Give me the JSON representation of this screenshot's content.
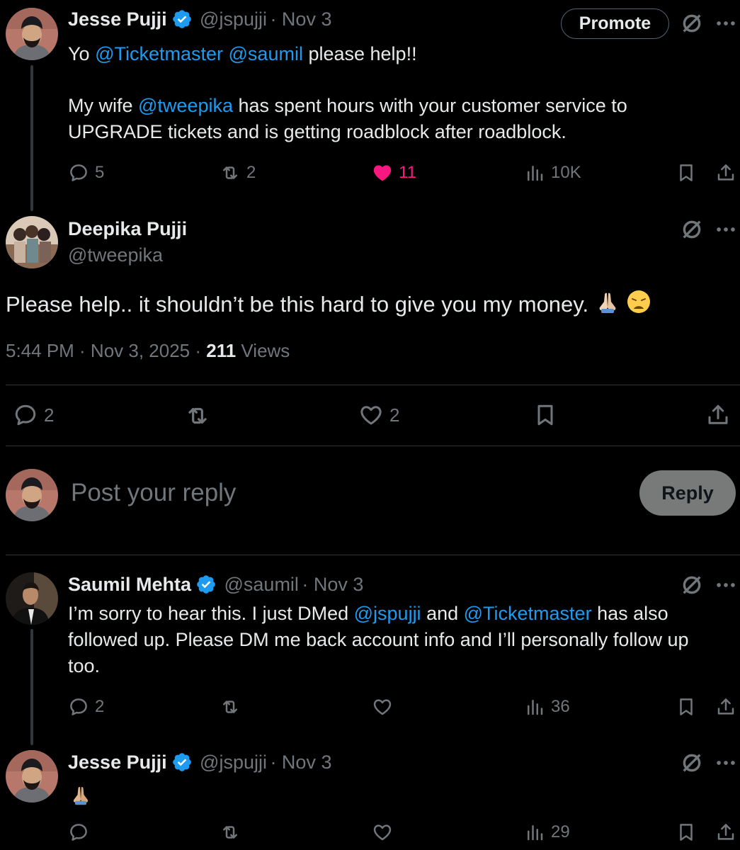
{
  "tweets": [
    {
      "name": "Jesse Pujji",
      "handle": "@jspujji",
      "date": "· Nov 3",
      "promote_label": "Promote",
      "line1_prefix": "Yo ",
      "line1_m1": "@Ticketmaster",
      "line1_m2": "@saumil",
      "line1_suffix": " please help!!",
      "line2_prefix": "My wife ",
      "line2_mention": "@tweepika",
      "line2_suffix": " has spent hours with your customer service to",
      "line3": "UPGRADE tickets and is getting roadblock after roadblock.",
      "replies": "5",
      "reposts": "2",
      "likes": "11",
      "views": "10K"
    },
    {
      "name": "Deepika Pujji",
      "handle": "@tweepika",
      "text": "Please help.. it shouldn’t be this hard to give you my money.",
      "time": "5:44 PM · Nov 3, 2025 · ",
      "views_count": "211",
      "views_label": " Views",
      "replies": "2",
      "likes": "2"
    },
    {
      "name": "Saumil Mehta",
      "handle": "@saumil",
      "date": "· Nov 3",
      "l1_prefix": "I’m sorry to hear this. I just DMed ",
      "l1_m1": "@jspujji",
      "l1_mid": " and ",
      "l1_m2": "@Ticketmaster",
      "l1_suffix": " has also",
      "l2": "followed up. Please DM me back account info and I’ll personally follow up",
      "l3": "too.",
      "replies": "2",
      "views": "36"
    },
    {
      "name": "Jesse Pujji",
      "handle": "@jspujji",
      "date": "· Nov 3",
      "views": "29"
    }
  ],
  "composer": {
    "placeholder": "Post your reply",
    "reply_label": "Reply"
  },
  "icons": {
    "verified": "verified-badge-icon",
    "grok": "grok-icon",
    "more": "more-icon",
    "reply": "reply-icon",
    "repost": "repost-icon",
    "like": "like-icon",
    "views": "views-icon",
    "bookmark": "bookmark-icon",
    "share": "share-icon"
  },
  "colors": {
    "background": "#000000",
    "text": "#e7e9ea",
    "secondary": "#71767b",
    "link": "#1d9bf0",
    "like": "#f91880",
    "verified": "#1d9bf0"
  }
}
